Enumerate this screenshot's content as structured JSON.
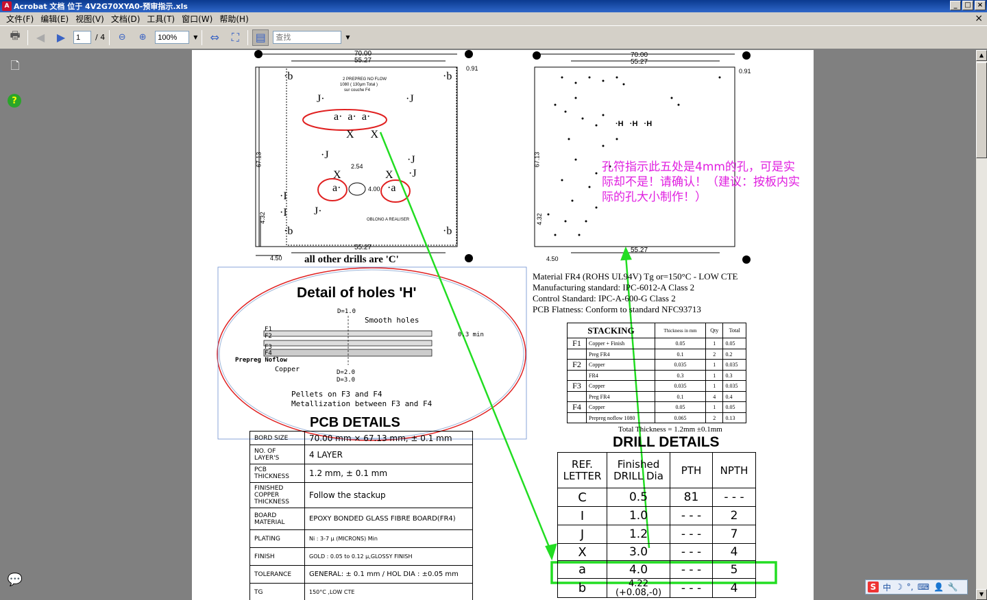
{
  "window": {
    "title": "Acrobat 文档 位于 4V2G70XYA0-预审指示.xls",
    "buttons": [
      "_",
      "□",
      "×"
    ]
  },
  "menu": [
    "文件(F)",
    "编辑(E)",
    "视图(V)",
    "文档(D)",
    "工具(T)",
    "窗口(W)",
    "帮助(H)"
  ],
  "toolbar": {
    "page_current": "1",
    "page_total": "/ 4",
    "zoom": "100%",
    "find_placeholder": "查找"
  },
  "drawing_left": {
    "dim_top_70": "70.00",
    "dim_top_5527": "55.27",
    "dim_091": "0.91",
    "dim_6713": "67.13",
    "dim_432": "4.32",
    "dim_450": "4.50",
    "dim_bottom_5527": "55.27",
    "prepreg_note_1": "2 PREPREG NO FLOW",
    "prepreg_note_2": "1080 ( 130µm Total )",
    "prepreg_note_3": "sur couche F4",
    "dim_254": "2.54",
    "dim_400": "4.00",
    "oblong_note": "OBLONG A REALISER",
    "other_drills": "all other drills are 'C'"
  },
  "drawing_right": {
    "dim_top_70": "70.00",
    "dim_top_5527": "55.27",
    "dim_091": "0.91",
    "dim_6713": "67.13",
    "dim_432": "4.32",
    "dim_450": "4.50",
    "dim_bottom_5527": "55.27"
  },
  "annotation": "孔符指示此五处是4mm的孔，可是实际却不是！请确认！（建议：按板内实际的孔大小制作！）",
  "detail_h": {
    "title": "Detail of holes 'H'",
    "d10": "D=1.0",
    "smooth": "Smooth holes",
    "f1": "F1",
    "f2": "F2",
    "f3": "F3",
    "f4": "F4",
    "min": "0.3 min",
    "prepreg": "Prepreg Noflow",
    "copper": "Copper",
    "d20": "D=2.0",
    "d30": "D=3.0",
    "pellets": "Pellets on F3 and F4",
    "metal": "Metallization between F3 and F4"
  },
  "material_info": [
    "Material FR4 (ROHS UL94V) Tg or=150°C - LOW CTE",
    "Manufacturing standard: IPC-6012-A Class 2",
    "Control Standard: IPC-A-600-G Class 2",
    "PCB Flatness: Conform to standard NFC93713"
  ],
  "stacking": {
    "title": "STACKING",
    "headers": [
      "Thickness in mm",
      "Qty",
      "Total"
    ],
    "rows": [
      {
        "layer": "F1",
        "mat": "Copper + Finish",
        "th": "0.05",
        "qty": "1",
        "total": "0.05"
      },
      {
        "layer": "",
        "mat": "Preg FR4",
        "th": "0.1",
        "qty": "2",
        "total": "0.2"
      },
      {
        "layer": "F2",
        "mat": "Copper",
        "th": "0.035",
        "qty": "1",
        "total": "0.035"
      },
      {
        "layer": "",
        "mat": "FR4",
        "th": "0.3",
        "qty": "1",
        "total": "0.3"
      },
      {
        "layer": "F3",
        "mat": "Copper",
        "th": "0.035",
        "qty": "1",
        "total": "0.035"
      },
      {
        "layer": "",
        "mat": "Preg FR4",
        "th": "0.1",
        "qty": "4",
        "total": "0.4"
      },
      {
        "layer": "F4",
        "mat": "Copper",
        "th": "0.05",
        "qty": "1",
        "total": "0.05"
      },
      {
        "layer": "",
        "mat": "Prepreg noflow 1080",
        "th": "0.065",
        "qty": "2",
        "total": "0.13"
      }
    ],
    "total_thickness": "Total Thickness = 1.2mm ±0.1mm"
  },
  "pcb_details": {
    "title": "PCB DETAILS",
    "rows": [
      {
        "k": "BORD SIZE",
        "v": "70.00 mm × 67.13 mm, ± 0.1 mm"
      },
      {
        "k": "NO. OF LAYER'S",
        "v": "4 LAYER"
      },
      {
        "k": "PCB THICKNESS",
        "v": "1.2 mm, ± 0.1 mm"
      },
      {
        "k": "FINISHED COPPER THICKNESS",
        "v": "Follow the stackup"
      },
      {
        "k": "BOARD MATERIAL",
        "v": "EPOXY BONDED GLASS FIBRE BOARD(FR4)"
      },
      {
        "k": "PLATING",
        "v": "Ni : 3-7 µ (MICRONS) Min"
      },
      {
        "k": "FINISH",
        "v": "GOLD : 0.05 to 0.12 µ,GLOSSY FINISH"
      },
      {
        "k": "TOLERANCE",
        "v": "GENERAL: ± 0.1 mm / HOL DIA : ±0.05 mm"
      },
      {
        "k": "TG",
        "v": "150°C ,LOW CTE"
      }
    ]
  },
  "drill_details": {
    "title": "DRILL DETAILS",
    "headers": [
      "REF. LETTER",
      "Finished DRILL Dia",
      "PTH",
      "NPTH"
    ],
    "rows": [
      {
        "ref": "C",
        "dia": "0.5",
        "pth": "81",
        "npth": "- - -"
      },
      {
        "ref": "I",
        "dia": "1.0",
        "pth": "- - -",
        "npth": "2"
      },
      {
        "ref": "J",
        "dia": "1.2",
        "pth": "- - -",
        "npth": "7"
      },
      {
        "ref": "X",
        "dia": "3.0",
        "pth": "- - -",
        "npth": "4"
      },
      {
        "ref": "a",
        "dia": "4.0",
        "pth": "- - -",
        "npth": "5"
      },
      {
        "ref": "b",
        "dia": "4.22 (+0.08,-0)",
        "pth": "- - -",
        "npth": "4"
      }
    ]
  },
  "ime": {
    "logo": "S",
    "mode": "中"
  },
  "colors": {
    "annotation": "#e020e0",
    "arrow": "#22dd22",
    "circle": "#e02020",
    "highlight": "#22dd22"
  }
}
